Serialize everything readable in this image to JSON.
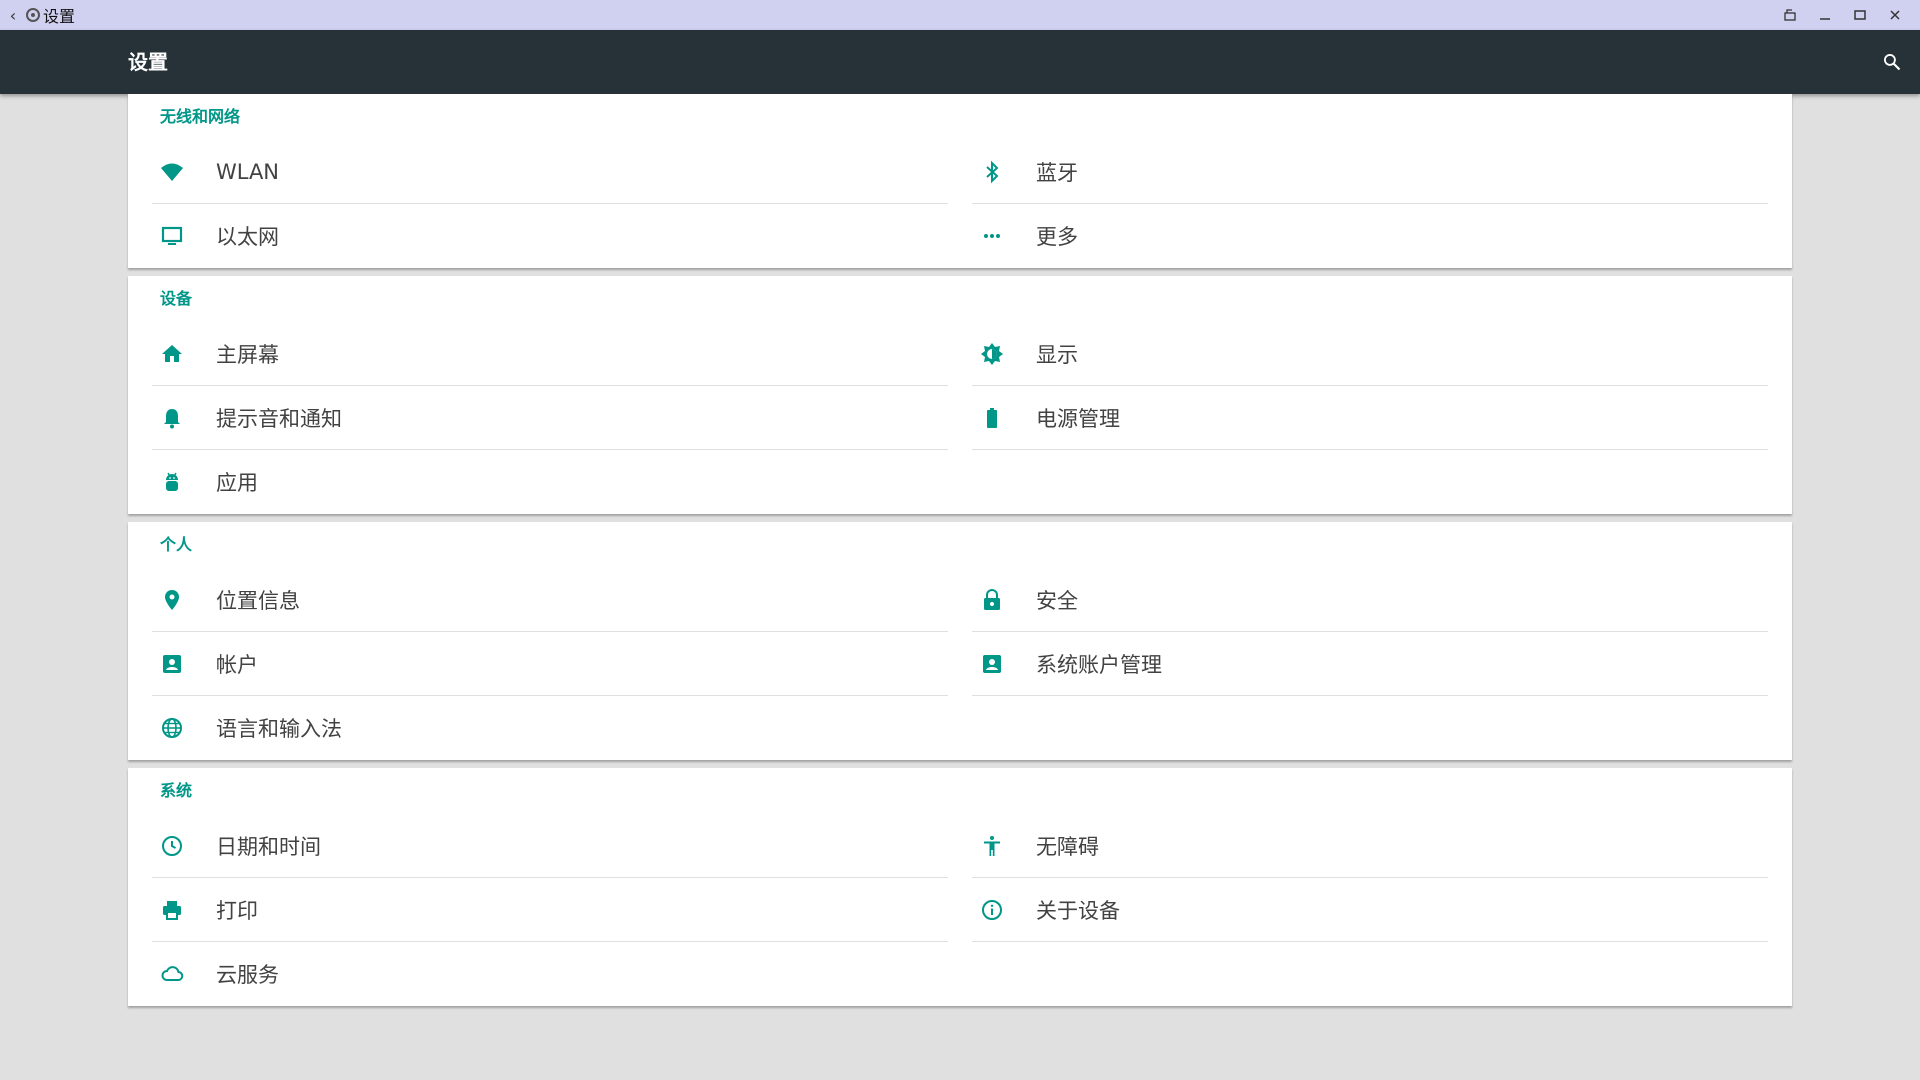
{
  "window": {
    "title": "设置"
  },
  "toolbar": {
    "title": "设置"
  },
  "colors": {
    "accent": "#009688",
    "toolbar": "#263238",
    "background": "#e0e0e0"
  },
  "sections": [
    {
      "header": "无线和网络",
      "items": [
        {
          "label": "WLAN",
          "icon": "wifi-icon"
        },
        {
          "label": "蓝牙",
          "icon": "bluetooth-icon"
        },
        {
          "label": "以太网",
          "icon": "ethernet-monitor-icon"
        },
        {
          "label": "更多",
          "icon": "more-dots-icon"
        }
      ]
    },
    {
      "header": "设备",
      "items": [
        {
          "label": "主屏幕",
          "icon": "home-icon"
        },
        {
          "label": "显示",
          "icon": "brightness-icon"
        },
        {
          "label": "提示音和通知",
          "icon": "bell-icon"
        },
        {
          "label": "电源管理",
          "icon": "battery-icon"
        },
        {
          "label": "应用",
          "icon": "android-icon"
        }
      ]
    },
    {
      "header": "个人",
      "items": [
        {
          "label": "位置信息",
          "icon": "location-pin-icon"
        },
        {
          "label": "安全",
          "icon": "lock-icon"
        },
        {
          "label": "帐户",
          "icon": "account-box-icon"
        },
        {
          "label": "系统账户管理",
          "icon": "account-box-icon"
        },
        {
          "label": "语言和输入法",
          "icon": "globe-icon"
        }
      ]
    },
    {
      "header": "系统",
      "items": [
        {
          "label": "日期和时间",
          "icon": "clock-icon"
        },
        {
          "label": "无障碍",
          "icon": "accessibility-icon"
        },
        {
          "label": "打印",
          "icon": "printer-icon"
        },
        {
          "label": "关于设备",
          "icon": "info-icon"
        },
        {
          "label": "云服务",
          "icon": "cloud-icon"
        }
      ]
    }
  ]
}
